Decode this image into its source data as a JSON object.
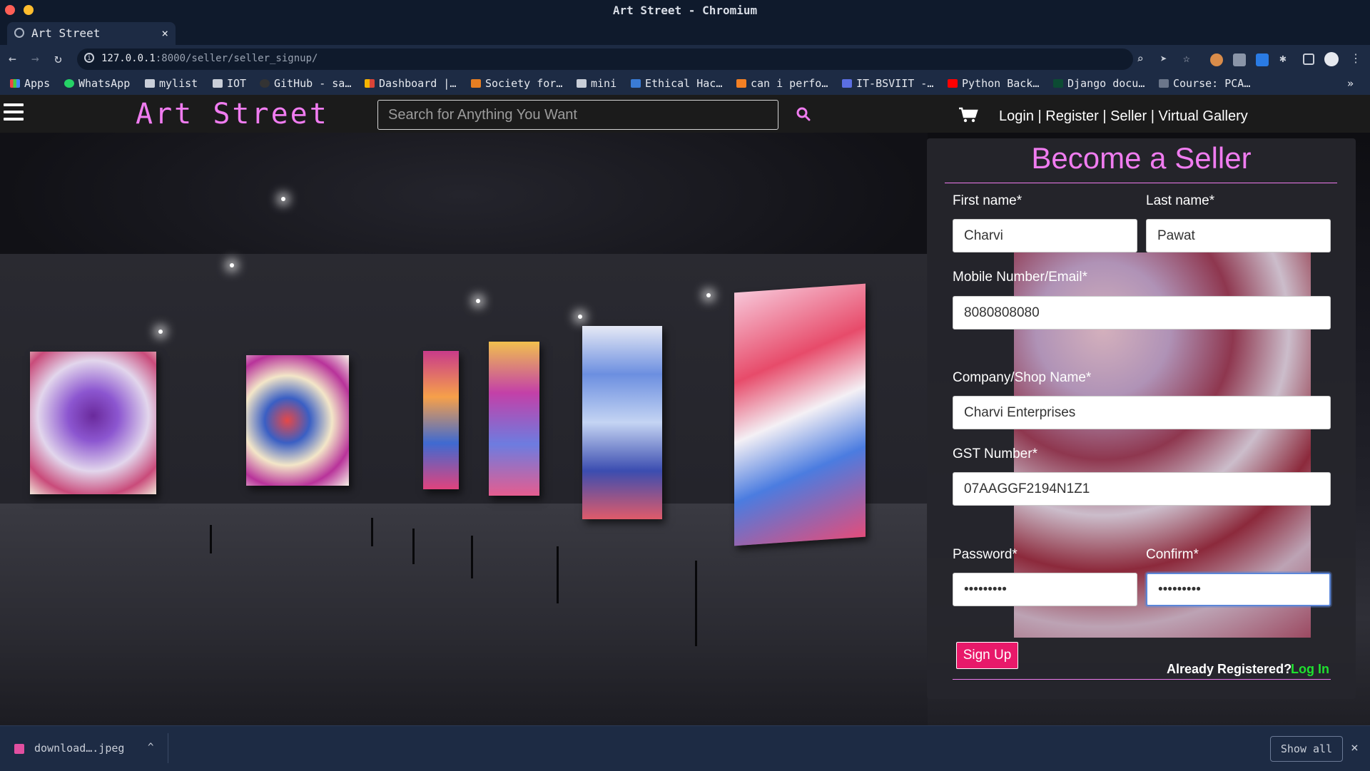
{
  "browser": {
    "window_title": "Art Street - Chromium",
    "tab_title": "Art Street",
    "tab_close": "×",
    "new_tab": "+",
    "url_host": "127.0.0.1",
    "url_rest": ":8000/seller/seller_signup/",
    "bookmarks": [
      "Apps",
      "WhatsApp",
      "mylist",
      "IOT",
      "GitHub - sa…",
      "Dashboard |…",
      "Society for…",
      "mini",
      "Ethical Hac…",
      "can i perfo…",
      "IT-BSVIIT -…",
      "Python Back…",
      "Django docu…",
      "Course: PCA…"
    ],
    "bookmarks_more": "»"
  },
  "site": {
    "logo": "Art Street",
    "search_placeholder": "Search for Anything You Want",
    "nav": [
      "Login",
      "Register",
      "Seller",
      "Virtual Gallery"
    ],
    "nav_sep": "|"
  },
  "form": {
    "title": "Become a Seller",
    "first_name_label": "First name*",
    "first_name_value": "Charvi",
    "last_name_label": "Last name*",
    "last_name_value": "Pawat",
    "mobile_label": "Mobile Number/Email*",
    "mobile_value": "8080808080",
    "company_label": "Company/Shop Name*",
    "company_value": "Charvi Enterprises",
    "gst_label": "GST Number*",
    "gst_value": "07AAGGF2194N1Z1",
    "password_label": "Password*",
    "password_value": "passwordx",
    "confirm_label": "Confirm*",
    "confirm_value": "passwordx",
    "signup_button": "Sign Up",
    "already_registered": "Already Registered?",
    "login_link": "Log In"
  },
  "download_bar": {
    "file_name": "download….jpeg",
    "show_all": "Show all",
    "close": "×"
  },
  "colors": {
    "accent_pink": "#f07cf0",
    "button_pink": "#e8196a",
    "link_green": "#1fe02f",
    "chrome_dark": "#1d2b44"
  }
}
